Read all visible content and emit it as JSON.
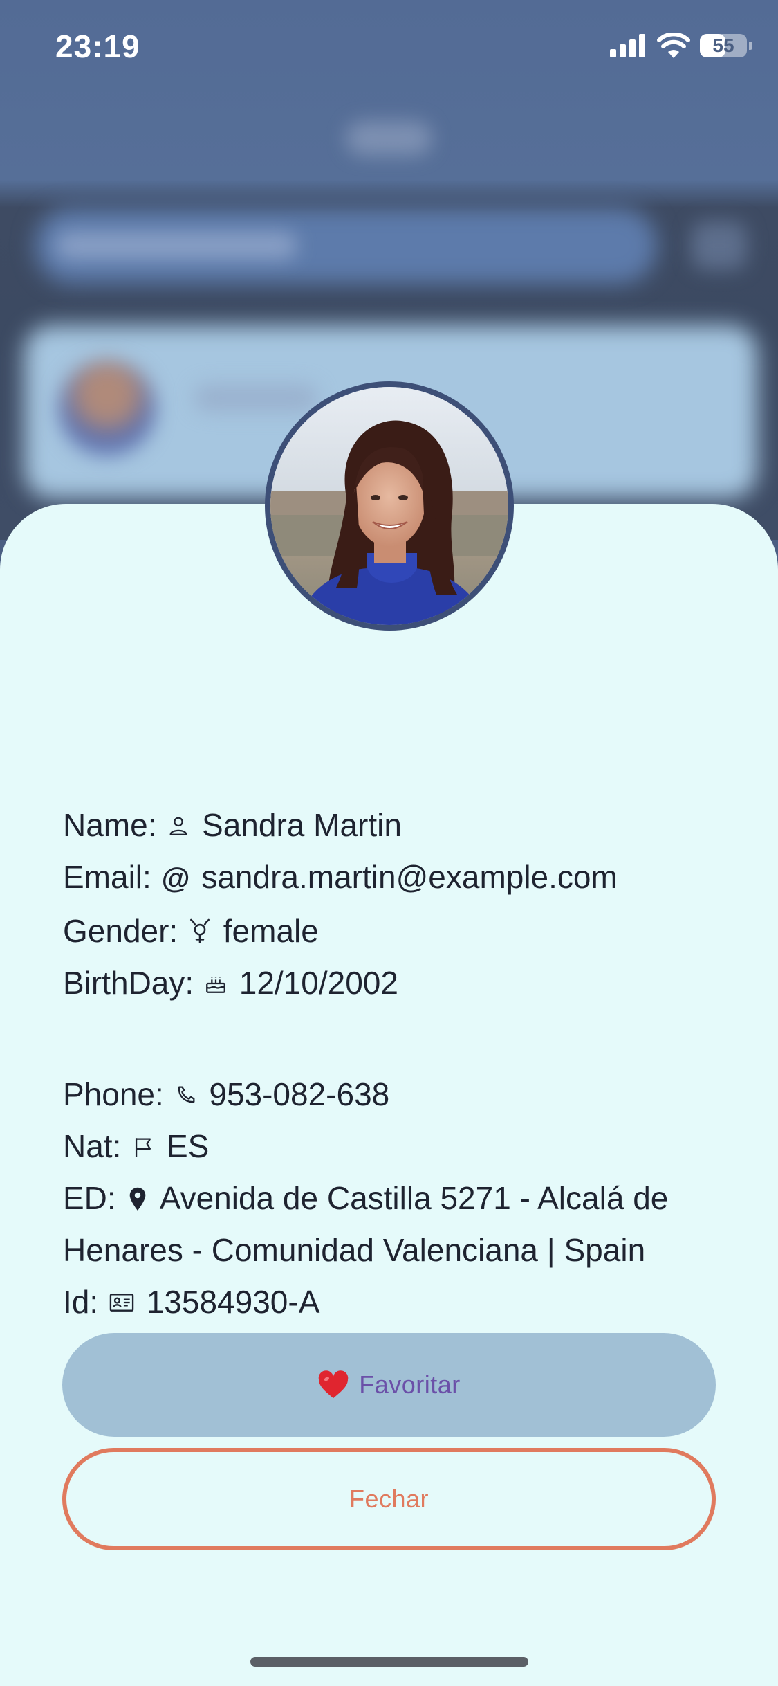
{
  "status_bar": {
    "time": "23:19",
    "battery": "55",
    "battery_level_percent": 55
  },
  "profile": {
    "avatar_alt": "profile photo",
    "rows": [
      {
        "label": "Name:",
        "icon": "person-icon",
        "value": "Sandra Martin"
      },
      {
        "label": "Email:",
        "icon": "at-icon",
        "value": "sandra.martin@example.com"
      },
      {
        "label": "Gender:",
        "icon": "gender-icon",
        "value": "female"
      },
      {
        "label": "BirthDay:",
        "icon": "cake-icon",
        "value": "12/10/2002"
      },
      {
        "label": "Phone:",
        "icon": "phone-icon",
        "value": "953-082-638"
      },
      {
        "label": "Nat:",
        "icon": "flag-icon",
        "value": "ES"
      },
      {
        "label": "ED:",
        "icon": "location-pin-icon",
        "value": "Avenida de Castilla 5271 - Alcalá de Henares - Comunidad Valenciana | Spain"
      },
      {
        "label": "Id:",
        "icon": "id-card-icon",
        "value": "13584930-A"
      }
    ]
  },
  "actions": {
    "favorite_label": "Favoritar",
    "close_label": "Fechar"
  },
  "colors": {
    "sheet_background": "#e5fafa",
    "favorite_button": "#a1c0d5",
    "favorite_text": "#6b50a8",
    "close_accent": "#e07a5e",
    "avatar_border": "#3d4f77"
  }
}
